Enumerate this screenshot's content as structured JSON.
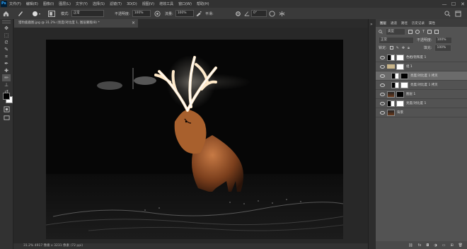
{
  "app": {
    "logo": "Ps"
  },
  "menu": {
    "items": [
      "文件(F)",
      "编辑(E)",
      "图像(I)",
      "图层(L)",
      "文字(Y)",
      "选择(S)",
      "滤镜(T)",
      "3D(D)",
      "视图(V)",
      "增效工具",
      "窗口(W)",
      "帮助(H)"
    ]
  },
  "window": {
    "minimize": "—",
    "maximize": "☐",
    "close": "✕"
  },
  "options": {
    "mode_label": "模式:",
    "mode_value": "正常",
    "opacity_label": "不透明度:",
    "opacity_value": "100%",
    "flow_label": "流量:",
    "flow_value": "100%",
    "smooth_label": "平滑:",
    "angle_value": "0°"
  },
  "document": {
    "tab_title": "猎豹鹿鹿图.jpg @ 31.2% (亮度/对比度 1, 图层蒙版/8) *",
    "tab_close": "×"
  },
  "status": {
    "text": "31.2%  4917 像素 x 3231 像素 (72 ppi)"
  },
  "layers_panel": {
    "tabs": [
      "图层",
      "通道",
      "路径",
      "历史记录",
      "属性"
    ],
    "filter_label": "类型",
    "blend_value": "正常",
    "opacity_label": "不透明度:",
    "opacity_value": "100%",
    "lock_label": "锁定:",
    "fill_label": "填充:",
    "fill_value": "100%",
    "layers": [
      {
        "name": "色相/饱和度 1"
      },
      {
        "name": "组 1"
      },
      {
        "name": "亮度/对比度 1 拷贝"
      },
      {
        "name": "亮度/对比度 1 拷贝"
      },
      {
        "name": "图层 1"
      },
      {
        "name": "亮度/对比度 1"
      },
      {
        "name": "背景"
      }
    ],
    "bottom_icons": [
      "link-icon",
      "fx-icon",
      "mask-icon",
      "adjustment-icon",
      "group-icon",
      "new-layer-icon",
      "trash-icon"
    ]
  },
  "tools": [
    "move-icon",
    "marquee-icon",
    "lasso-icon",
    "quick-select-icon",
    "crop-icon",
    "eyedropper-icon",
    "healing-icon",
    "brush-icon",
    "stamp-icon",
    "history-brush-icon",
    "eraser-icon",
    "gradient-icon",
    "blur-icon",
    "dodge-icon",
    "pen-icon",
    "type-icon",
    "path-select-icon",
    "shape-icon",
    "hand-icon",
    "zoom-icon"
  ],
  "colors": {
    "foreground": "#000000",
    "background": "#ffffff",
    "accent": "#31a8ff"
  }
}
